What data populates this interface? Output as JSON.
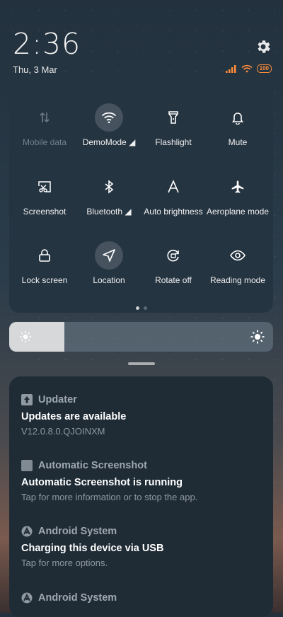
{
  "status": {
    "time": "2:36",
    "date": "Thu, 3 Mar",
    "battery": "100",
    "icons": [
      "signal-icon",
      "wifi-icon",
      "battery-icon",
      "gear-icon"
    ]
  },
  "quick_settings": {
    "tiles": [
      {
        "label": "Mobile data",
        "icon": "mobile-data-icon",
        "active": false,
        "disabled": true
      },
      {
        "label": "DemoMode ◢",
        "icon": "wifi-icon",
        "active": true,
        "disabled": false
      },
      {
        "label": "Flashlight",
        "icon": "flashlight-icon",
        "active": false,
        "disabled": false
      },
      {
        "label": "Mute",
        "icon": "bell-icon",
        "active": false,
        "disabled": false
      },
      {
        "label": "Screenshot",
        "icon": "screenshot-icon",
        "active": false,
        "disabled": false
      },
      {
        "label": "Bluetooth ◢",
        "icon": "bluetooth-icon",
        "active": false,
        "disabled": false
      },
      {
        "label": "Auto brightness",
        "icon": "auto-brightness-icon",
        "active": false,
        "disabled": false
      },
      {
        "label": "Aeroplane mode",
        "icon": "airplane-icon",
        "active": false,
        "disabled": false
      },
      {
        "label": "Lock screen",
        "icon": "lock-icon",
        "active": false,
        "disabled": false
      },
      {
        "label": "Location",
        "icon": "location-icon",
        "active": true,
        "disabled": false
      },
      {
        "label": "Rotate off",
        "icon": "rotate-icon",
        "active": false,
        "disabled": false
      },
      {
        "label": "Reading mode",
        "icon": "eye-icon",
        "active": false,
        "disabled": false
      }
    ],
    "page_count": 2,
    "current_page": 1
  },
  "brightness": {
    "level": 0.21
  },
  "notifications": [
    {
      "app": "Updater",
      "icon": "updater-icon",
      "title": "Updates are available",
      "body": "V12.0.8.0.QJOINXM"
    },
    {
      "app": "Automatic Screenshot",
      "icon": "screenshot-app-icon",
      "title": "Automatic Screenshot is running",
      "body": "Tap for more information or to stop the app."
    },
    {
      "app": "Android System",
      "icon": "android-system-icon",
      "title": "Charging this device via USB",
      "body": "Tap for more options."
    },
    {
      "app": "Android System",
      "icon": "android-system-icon",
      "title": "",
      "body": ""
    }
  ],
  "colors": {
    "panel": "#253441",
    "active_tile": "#46535e",
    "battery_accent": "#ff8c3a",
    "notification_panel": "#1f2b35"
  }
}
